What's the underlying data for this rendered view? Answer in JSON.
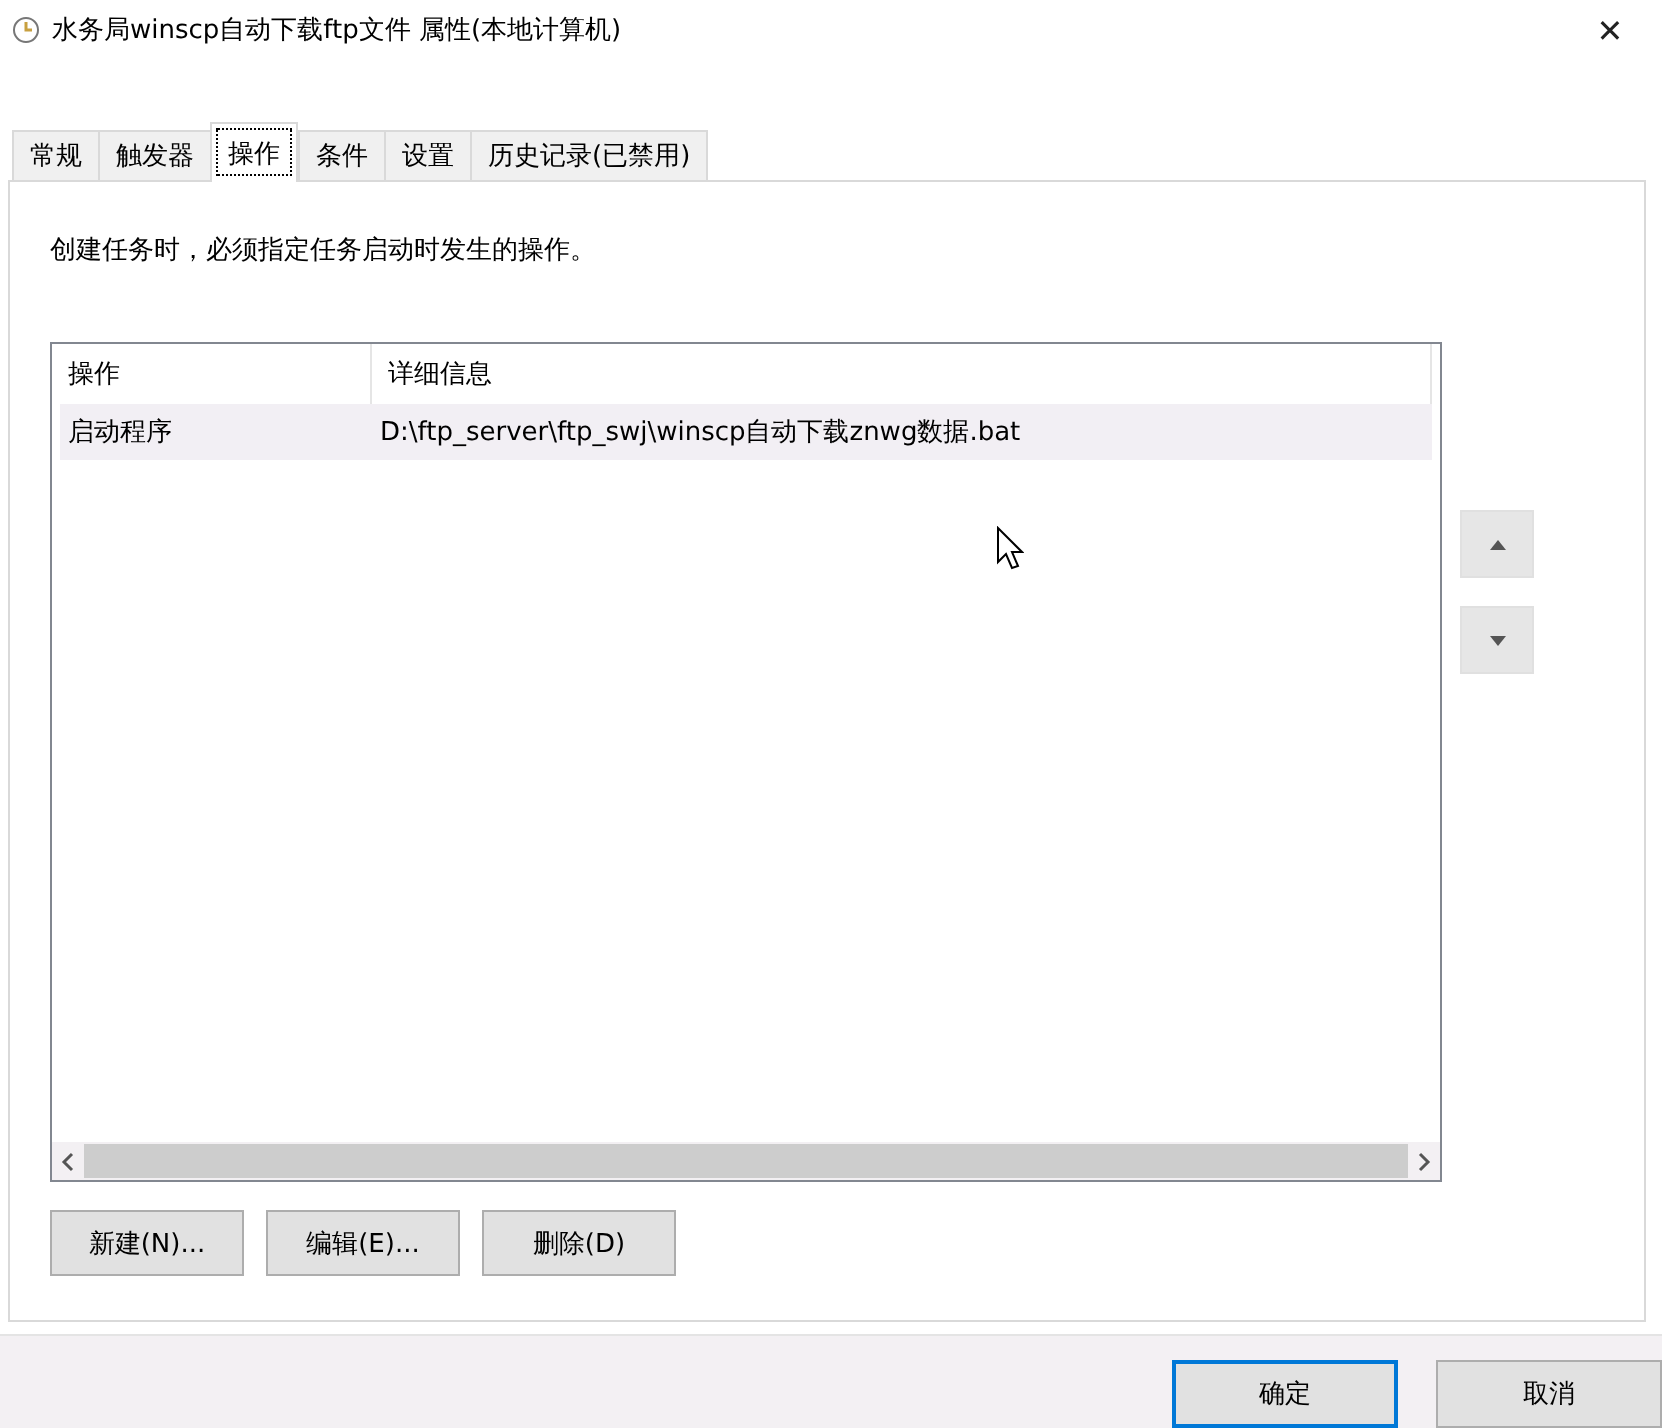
{
  "window": {
    "title": "水务局winscp自动下载ftp文件 属性(本地计算机)",
    "close": "✕"
  },
  "tabs": [
    {
      "label": "常规",
      "selected": false
    },
    {
      "label": "触发器",
      "selected": false
    },
    {
      "label": "操作",
      "selected": true
    },
    {
      "label": "条件",
      "selected": false
    },
    {
      "label": "设置",
      "selected": false
    },
    {
      "label": "历史记录(已禁用)",
      "selected": false
    }
  ],
  "description": "创建任务时，必须指定任务启动时发生的操作。",
  "table": {
    "columns": [
      "操作",
      "详细信息"
    ],
    "rows": [
      {
        "cells": [
          "启动程序",
          "D:\\ftp_server\\ftp_swj\\winscp自动下载znwg数据.bat"
        ],
        "selected": true
      }
    ]
  },
  "action_buttons": [
    "新建(N)...",
    "编辑(E)...",
    "删除(D)"
  ],
  "dialog_buttons": [
    {
      "label": "确定",
      "default": true
    },
    {
      "label": "取消",
      "default": false
    }
  ]
}
